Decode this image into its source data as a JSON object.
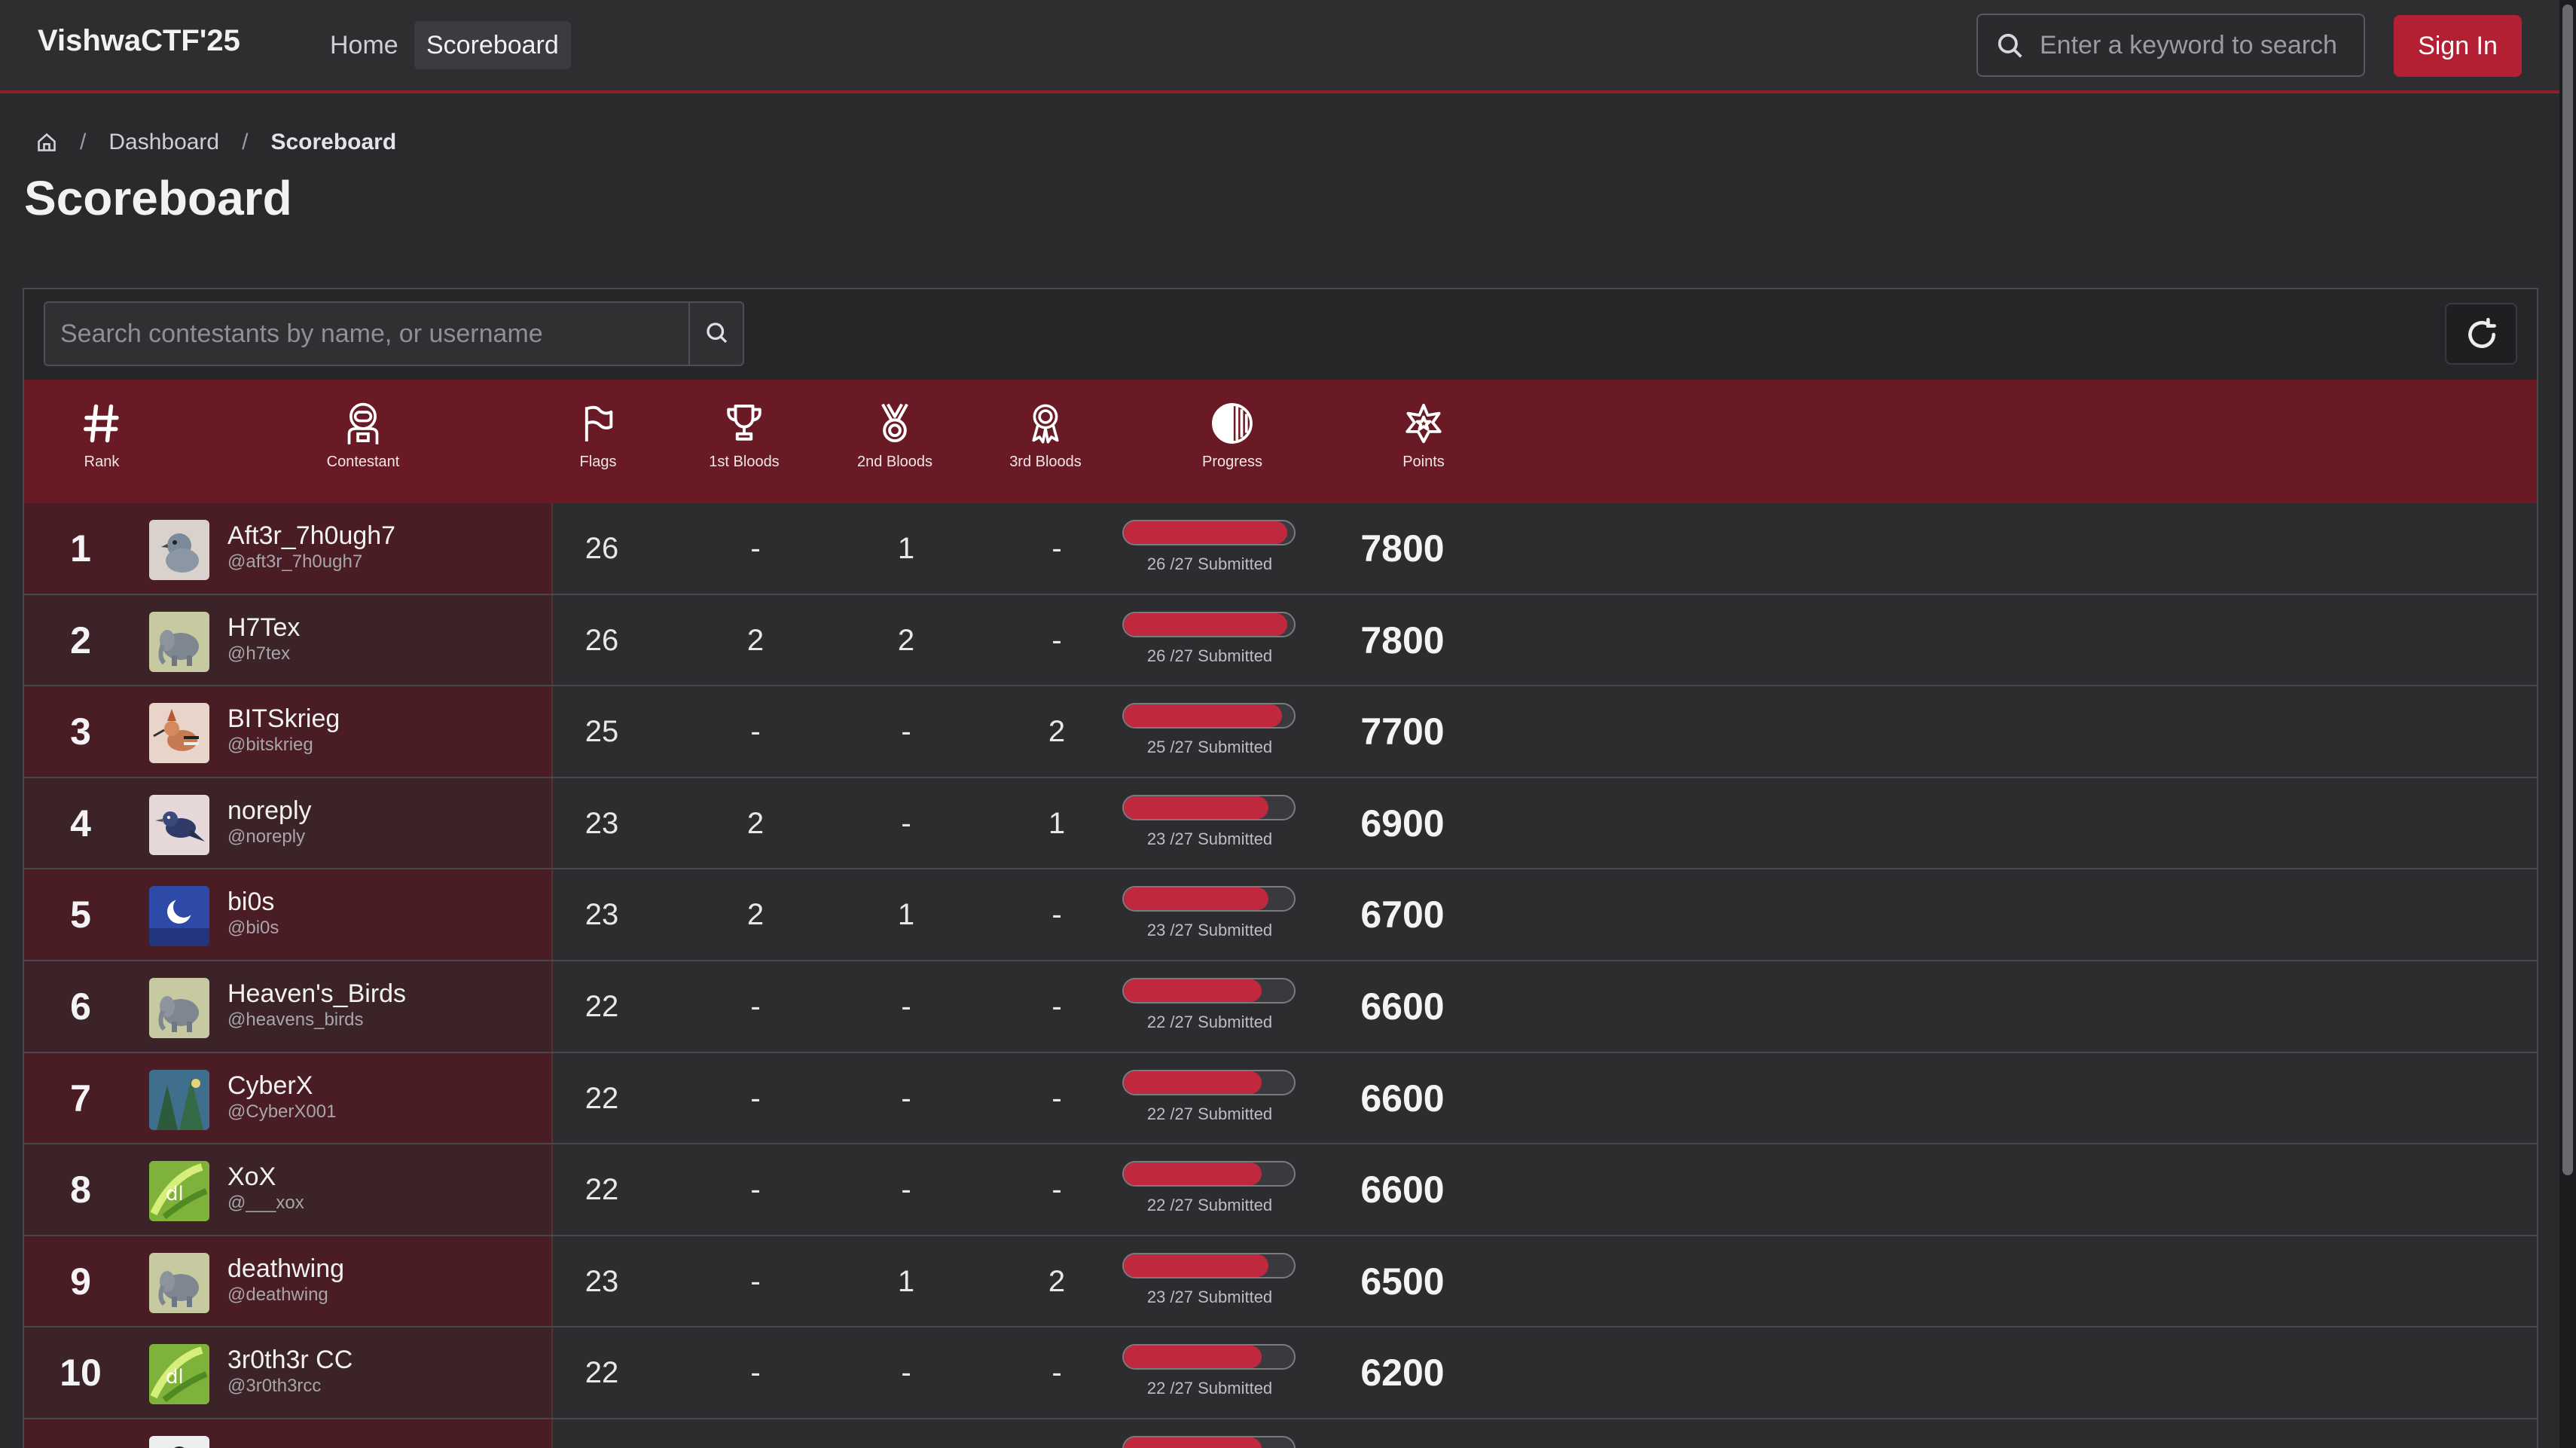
{
  "brand": "VishwaCTF'25",
  "nav": {
    "home": "Home",
    "scoreboard": "Scoreboard"
  },
  "search": {
    "placeholder": "Enter a keyword to search"
  },
  "signin": "Sign In",
  "breadcrumb": {
    "dashboard": "Dashboard",
    "current": "Scoreboard"
  },
  "page_title": "Scoreboard",
  "contestant_search": {
    "placeholder": "Search contestants by name, or username"
  },
  "columns": {
    "rank": "Rank",
    "contestant": "Contestant",
    "flags": "Flags",
    "first_bloods": "1st Bloods",
    "second_bloods": "2nd Bloods",
    "third_bloods": "3rd Bloods",
    "progress": "Progress",
    "points": "Points"
  },
  "colors": {
    "accent": "#b31f33",
    "header_bg": "#6a1a24",
    "progress_fill": "#c0293d"
  },
  "rows": [
    {
      "rank": "1",
      "name": "Aft3r_7h0ugh7",
      "handle": "@aft3r_7h0ugh7",
      "flags": "26",
      "b1": "-",
      "b2": "1",
      "b3": "-",
      "solved": 26,
      "total": 27,
      "submitted": "26 /27 Submitted",
      "points": "7800",
      "avatar": "pigeon",
      "avatar_bg": "#d9d2cc"
    },
    {
      "rank": "2",
      "name": "H7Tex",
      "handle": "@h7tex",
      "flags": "26",
      "b1": "2",
      "b2": "2",
      "b3": "-",
      "solved": 26,
      "total": 27,
      "submitted": "26 /27 Submitted",
      "points": "7800",
      "avatar": "elephant",
      "avatar_bg": "#c7c9a0"
    },
    {
      "rank": "3",
      "name": "BITSkrieg",
      "handle": "@bitskrieg",
      "flags": "25",
      "b1": "-",
      "b2": "-",
      "b3": "2",
      "solved": 25,
      "total": 27,
      "submitted": "25 /27 Submitted",
      "points": "7700",
      "avatar": "hoopoe",
      "avatar_bg": "#e9d4c9"
    },
    {
      "rank": "4",
      "name": "noreply",
      "handle": "@noreply",
      "flags": "23",
      "b1": "2",
      "b2": "-",
      "b3": "1",
      "solved": 23,
      "total": 27,
      "submitted": "23 /27 Submitted",
      "points": "6900",
      "avatar": "bird",
      "avatar_bg": "#e6d8d8"
    },
    {
      "rank": "5",
      "name": "bi0s",
      "handle": "@bi0s",
      "flags": "23",
      "b1": "2",
      "b2": "1",
      "b3": "-",
      "solved": 23,
      "total": 27,
      "submitted": "23 /27 Submitted",
      "points": "6700",
      "avatar": "moon",
      "avatar_bg": "#2e4aa8"
    },
    {
      "rank": "6",
      "name": "Heaven's_Birds",
      "handle": "@heavens_birds",
      "flags": "22",
      "b1": "-",
      "b2": "-",
      "b3": "-",
      "solved": 22,
      "total": 27,
      "submitted": "22 /27 Submitted",
      "points": "6600",
      "avatar": "elephant",
      "avatar_bg": "#c7c9a0"
    },
    {
      "rank": "7",
      "name": "CyberX",
      "handle": "@CyberX001",
      "flags": "22",
      "b1": "-",
      "b2": "-",
      "b3": "-",
      "solved": 22,
      "total": 27,
      "submitted": "22 /27 Submitted",
      "points": "6600",
      "avatar": "forest",
      "avatar_bg": "#3f6f8c"
    },
    {
      "rank": "8",
      "name": "XoX",
      "handle": "@___xox",
      "flags": "22",
      "b1": "-",
      "b2": "-",
      "b3": "-",
      "solved": 22,
      "total": 27,
      "submitted": "22 /27 Submitted",
      "points": "6600",
      "avatar": "leaves",
      "avatar_bg": "#7fb23a"
    },
    {
      "rank": "9",
      "name": "deathwing",
      "handle": "@deathwing",
      "flags": "23",
      "b1": "-",
      "b2": "1",
      "b3": "2",
      "solved": 23,
      "total": 27,
      "submitted": "23 /27 Submitted",
      "points": "6500",
      "avatar": "elephant",
      "avatar_bg": "#c7c9a0"
    },
    {
      "rank": "10",
      "name": "3r0th3r CC",
      "handle": "@3r0th3rcc",
      "flags": "22",
      "b1": "-",
      "b2": "-",
      "b3": "-",
      "solved": 22,
      "total": 27,
      "submitted": "22 /27 Submitted",
      "points": "6200",
      "avatar": "leaves",
      "avatar_bg": "#7fb23a"
    },
    {
      "rank": "",
      "name": "",
      "handle": "",
      "flags": "",
      "b1": "",
      "b2": "",
      "b3": "",
      "solved": 22,
      "total": 27,
      "submitted": "",
      "points": "",
      "avatar": "penguin",
      "avatar_bg": "#eeeeee"
    }
  ]
}
